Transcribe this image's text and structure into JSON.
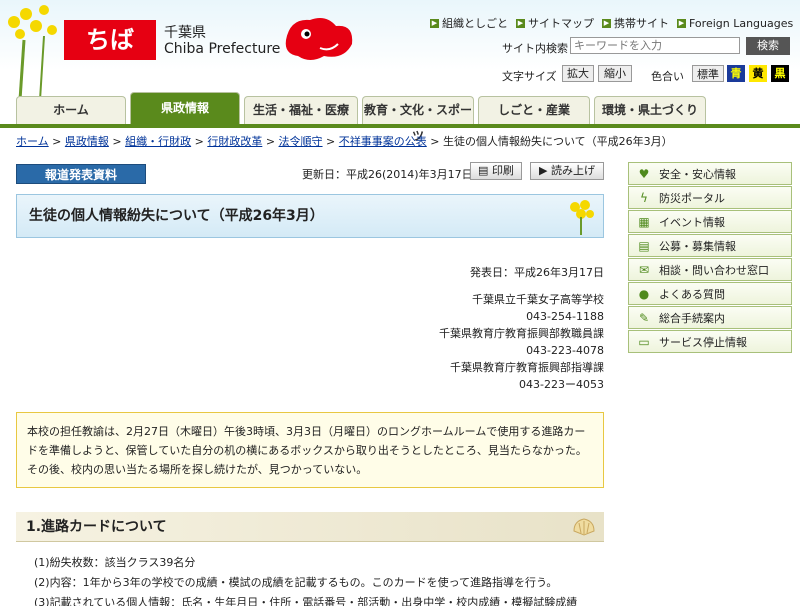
{
  "header": {
    "logo_text": "ちば",
    "pref_jp": "千葉県",
    "pref_en": "Chiba Prefecture",
    "top_links": [
      "組織としごと",
      "サイトマップ",
      "携帯サイト",
      "Foreign Languages"
    ],
    "search_label": "サイト内検索",
    "search_placeholder": "キーワードを入力",
    "search_button": "検索",
    "text_size_label": "文字サイズ",
    "size_large": "拡大",
    "size_small": "縮小",
    "color_label": "色合い",
    "color_standard": "標準",
    "color_blue": "青",
    "color_yellow": "黄",
    "color_black": "黒"
  },
  "nav": {
    "tabs": [
      "ホーム",
      "県政情報",
      "生活・福祉・医療",
      "教育・文化・スポーツ",
      "しごと・産業",
      "環境・県土づくり"
    ],
    "active_index": 1
  },
  "breadcrumb": {
    "links": [
      "ホーム",
      "県政情報",
      "組織・行財政",
      "行財政改革",
      "法令順守",
      "不祥事事案の公表"
    ],
    "current": "生徒の個人情報紛失について（平成26年3月）",
    "separator": ">"
  },
  "meta": {
    "report_label": "報道発表資料",
    "updated": "更新日：平成26(2014)年3月17日",
    "print": "印刷",
    "read_aloud": "読み上げ"
  },
  "article": {
    "title": "生徒の個人情報紛失について（平成26年3月）",
    "published": "発表日：平成26年3月17日",
    "contacts": [
      {
        "org": "千葉県立千葉女子高等学校",
        "tel": "043-254-1188"
      },
      {
        "org": "千葉県教育庁教育振興部教職員課",
        "tel": "043-223-4078"
      },
      {
        "org": "千葉県教育庁教育振興部指導課",
        "tel": "043-223ー4053"
      }
    ],
    "notice": "本校の担任教諭は、2月27日（木曜日）午後3時頃、3月3日（月曜日）のロングホームルームで使用する進路カードを準備しようと、保管していた自分の机の横にあるボックスから取り出そうとしたところ、見当たらなかった。その後、校内の思い当たる場所を探し続けたが、見つかっていない。",
    "section1_title": "1.進路カードについて",
    "section1_items": [
      "(1)紛失枚数：該当クラス39名分",
      "(2)内容：1年から3年の学校での成績・模試の成績を記載するもの。このカードを使って進路指導を行う。",
      "(3)記載されている個人情報：氏名・生年月日・住所・電話番号・部活動・出身中学・校内成績・模擬試験成績"
    ]
  },
  "sidebar": {
    "items": [
      {
        "label": "安全・安心情報",
        "icon": "heart-icon"
      },
      {
        "label": "防災ポータル",
        "icon": "lightning-icon"
      },
      {
        "label": "イベント情報",
        "icon": "calendar-icon"
      },
      {
        "label": "公募・募集情報",
        "icon": "document-icon"
      },
      {
        "label": "相談・問い合わせ窓口",
        "icon": "mail-icon"
      },
      {
        "label": "よくある質問",
        "icon": "speech-bubble-icon"
      },
      {
        "label": "総合手続案内",
        "icon": "pencil-icon"
      },
      {
        "label": "サービス停止情報",
        "icon": "monitor-icon"
      }
    ]
  },
  "colors": {
    "brand_red": "#e60012",
    "nav_green": "#5a8a1c",
    "report_blue": "#2a6aa8",
    "link_blue": "#003399"
  }
}
